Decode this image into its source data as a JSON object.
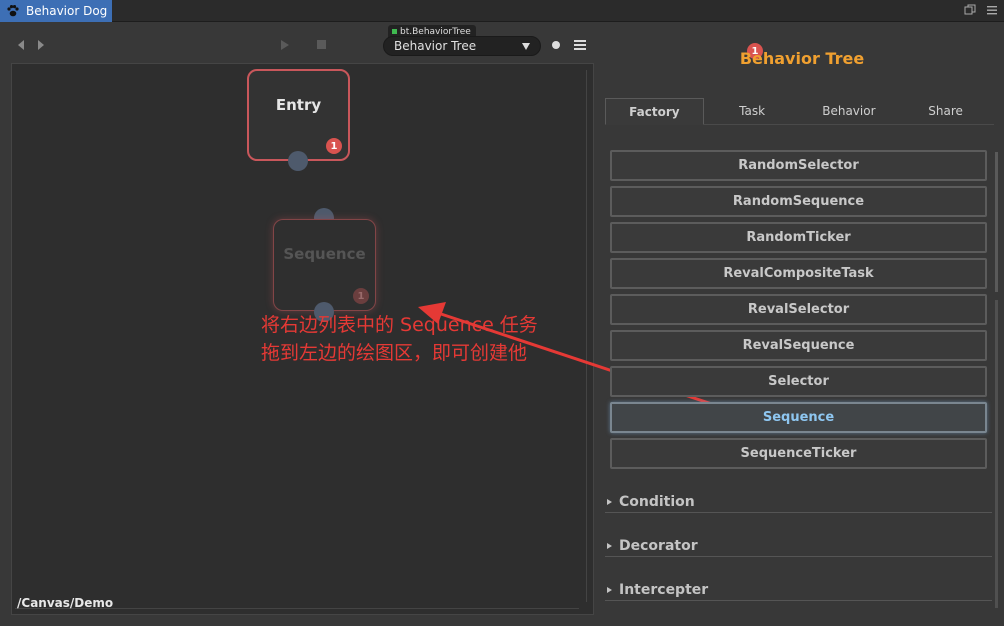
{
  "window": {
    "tab_title": "Behavior Dog"
  },
  "toolbar": {
    "tree_label": "bt.BehaviorTree",
    "tree_select_value": "Behavior Tree"
  },
  "canvas": {
    "entry_node": {
      "title": "Entry",
      "badge": "1"
    },
    "sequence_node": {
      "title": "Sequence",
      "badge": "1"
    },
    "path": "/Canvas/Demo",
    "annotation": {
      "line1": "将右边列表中的 Sequence 任务",
      "line2": "拖到左边的绘图区，即可创建他"
    }
  },
  "panel": {
    "title": "Behavior Tree",
    "title_badge": "1",
    "tabs": [
      "Factory",
      "Task",
      "Behavior",
      "Share"
    ],
    "active_tab": "Factory",
    "items": [
      "RandomSelector",
      "RandomSequence",
      "RandomTicker",
      "RevalCompositeTask",
      "RevalSelector",
      "RevalSequence",
      "Selector",
      "Sequence",
      "SequenceTicker"
    ],
    "highlighted_item": "Sequence",
    "sections": [
      "Condition",
      "Decorator",
      "Intercepter"
    ]
  },
  "colors": {
    "tab_accent": "#3d6fb5",
    "panel_title": "#f0a030",
    "node_border": "#c9575b",
    "badge": "#d9534f",
    "annotation": "#e53935",
    "highlight_text": "#8ec6f0"
  }
}
